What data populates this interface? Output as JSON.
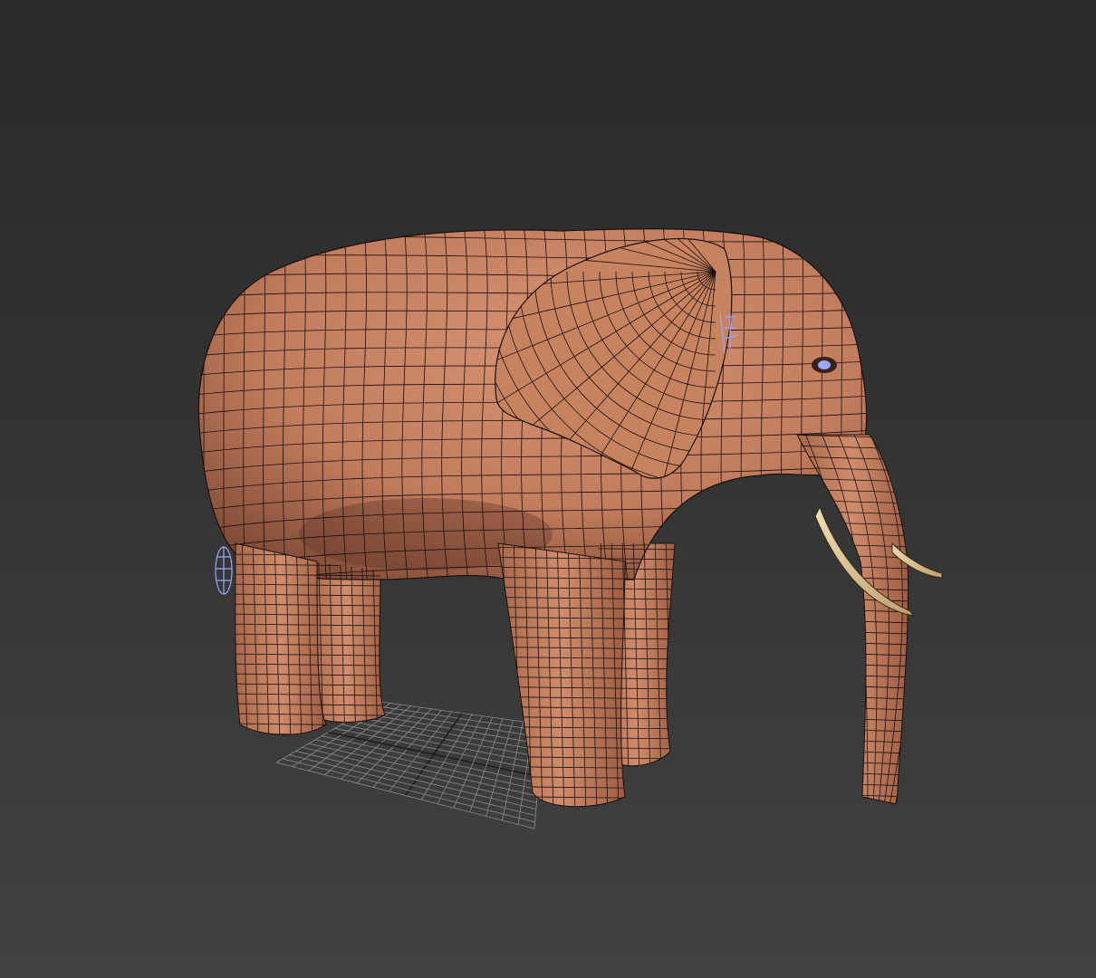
{
  "viewport": {
    "background_top": "#2a2a2a",
    "background_bottom": "#424242"
  },
  "model": {
    "subject": "elephant",
    "skin_color": "#c98463",
    "wire_color": "#1a0f0a",
    "tusk_color": "#d8c49a",
    "helper_color": "#9aa6ff"
  },
  "ground_grid": {
    "color": "#8a8a8a",
    "axis_color": "#1c1c1c"
  }
}
